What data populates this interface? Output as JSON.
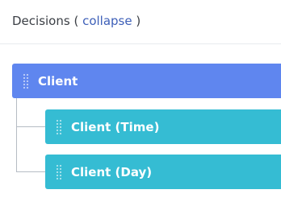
{
  "header": {
    "title": "Decisions",
    "open_paren": " ( ",
    "collapse_link": "collapse",
    "close_paren": " )"
  },
  "tree": {
    "root": {
      "label": "Client"
    },
    "children": [
      {
        "label": "Client (Time)"
      },
      {
        "label": "Client (Day)"
      }
    ]
  },
  "colors": {
    "root_node": "#5f86ef",
    "child_node": "#35bcd3",
    "link": "#3d5fb8"
  }
}
